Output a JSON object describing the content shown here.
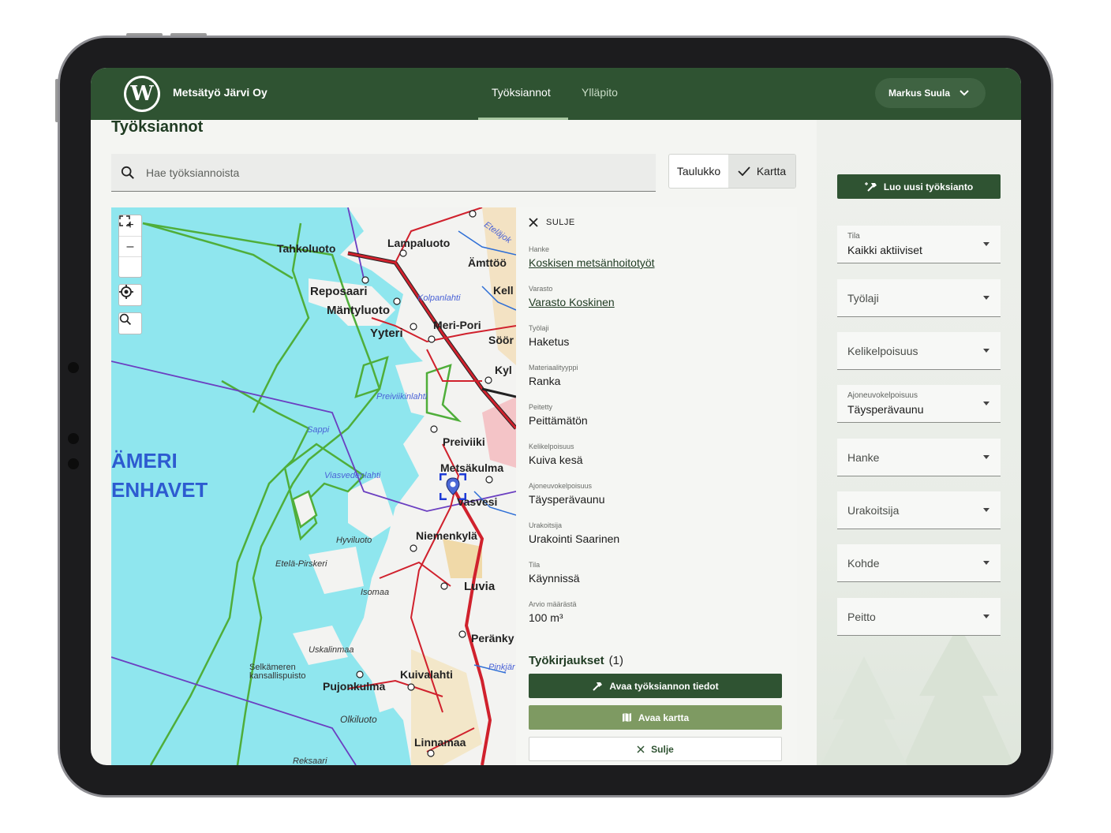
{
  "app": {
    "brand": "Metsätyö Järvi Oy",
    "logo_letter": "W"
  },
  "nav": {
    "tabs": [
      {
        "label": "Työksiannot"
      },
      {
        "label": "Ylläpito"
      }
    ],
    "user": "Markus Suula"
  },
  "page": {
    "title": "Työksiannot"
  },
  "search": {
    "placeholder": "Hae työksiannoista"
  },
  "view_toggle": {
    "table_label": "Taulukko",
    "map_label": "Kartta"
  },
  "map": {
    "controls": {
      "zoom_in": "+",
      "zoom_out": "–"
    },
    "places": [
      "Tahkoluoto",
      "Lampaluoto",
      "Ämttöö",
      "Reposaari",
      "Mäntyluoto",
      "Kolpanlahti",
      "Kell",
      "Yyteri",
      "Meri-Pori",
      "Söör",
      "Kyl",
      "Preiviikinlahti",
      "Sappi",
      "Preiviiki",
      "ÄMERI",
      "ENHAVET",
      "Metsäkulma",
      "Viasvedenlahti",
      "Vasvesi",
      "Niemenkylä",
      "Hyviluoto",
      "Etelä-Pirskeri",
      "Isomaa",
      "Luvia",
      "Uskalinmaa",
      "Peränky",
      "Pinkjär",
      "Selkämeren kansallispuisto",
      "Pujonkulma",
      "Kuivalahti",
      "Olkiluoto",
      "Linnamaa",
      "Reksaari",
      "Eteläjok"
    ]
  },
  "detail": {
    "close_label": "SULJE",
    "fields": [
      {
        "label": "Hanke",
        "value": "Koskisen metsänhoitotyöt"
      },
      {
        "label": "Varasto",
        "value": "Varasto Koskinen"
      },
      {
        "label": "Työlaji",
        "value": "Haketus"
      },
      {
        "label": "Materiaalityyppi",
        "value": "Ranka"
      },
      {
        "label": "Peitetty",
        "value": "Peittämätön"
      },
      {
        "label": "Kelikelpoisuus",
        "value": "Kuiva kesä"
      },
      {
        "label": "Ajoneuvokelpoisuus",
        "value": "Täysperävaunu"
      },
      {
        "label": "Urakoitsija",
        "value": "Urakointi Saarinen"
      },
      {
        "label": "Tila",
        "value": "Käynnissä"
      },
      {
        "label": "Arvio määrästä",
        "value": "100 m³"
      }
    ],
    "jobs_title": "Työkirjaukset",
    "jobs_count": "(1)",
    "open_details": "Avaa työksiannon tiedot",
    "open_map": "Avaa kartta",
    "close": "Sulje"
  },
  "sidebar": {
    "create": "Luo uusi työksianto",
    "filters": [
      {
        "label": "Tila",
        "value": "Kaikki aktiiviset"
      },
      {
        "label": "Työlaji"
      },
      {
        "label": "Kelikelpoisuus"
      },
      {
        "label": "Ajoneuvokelpoisuus",
        "value": "Täysperävaunu"
      },
      {
        "label": "Hanke"
      },
      {
        "label": "Urakoitsija"
      },
      {
        "label": "Kohde"
      },
      {
        "label": "Peitto"
      }
    ]
  },
  "colors": {
    "header": "#2f5332",
    "accent_light": "#7e9a62",
    "sea": "#8fe6ee",
    "land": "#f4f4f4"
  }
}
